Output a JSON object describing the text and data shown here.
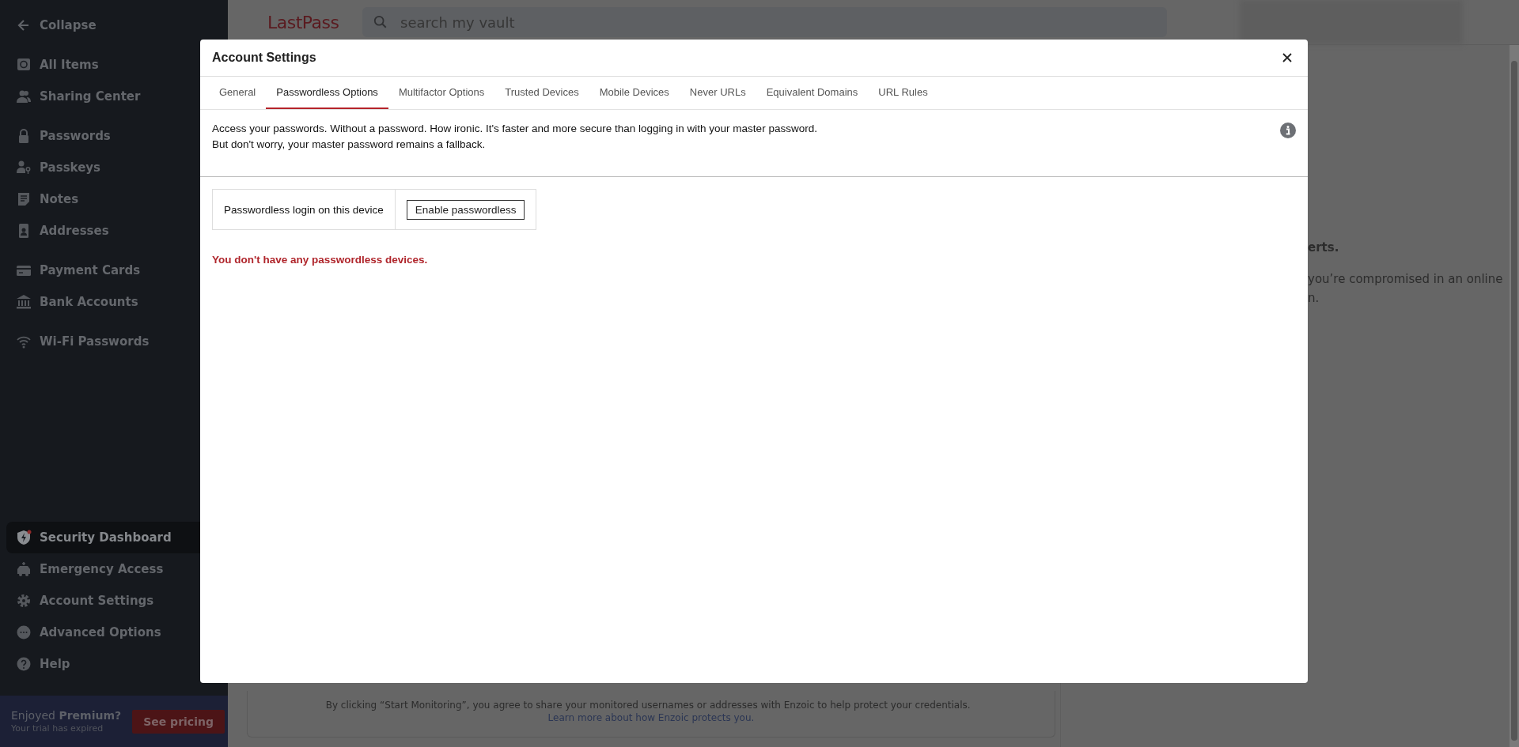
{
  "sidebar": {
    "collapse": "Collapse",
    "groups": [
      [
        {
          "label": "All Items",
          "selected": false
        },
        {
          "label": "Sharing Center",
          "selected": false
        }
      ],
      [
        {
          "label": "Passwords",
          "selected": false
        },
        {
          "label": "Passkeys",
          "selected": false
        },
        {
          "label": "Notes",
          "selected": false
        },
        {
          "label": "Addresses",
          "selected": false
        }
      ],
      [
        {
          "label": "Payment Cards",
          "selected": false
        },
        {
          "label": "Bank Accounts",
          "selected": false
        }
      ],
      [
        {
          "label": "Wi-Fi Passwords",
          "selected": false
        }
      ]
    ],
    "bottom_items": [
      {
        "label": "Security Dashboard",
        "selected": true
      },
      {
        "label": "Emergency Access",
        "selected": false
      },
      {
        "label": "Account Settings",
        "selected": false
      },
      {
        "label": "Advanced Options",
        "selected": false
      },
      {
        "label": "Help",
        "selected": false
      }
    ],
    "promo": {
      "headline": "Enjoyed **Premium?**",
      "subtext": "Your trial has expired",
      "button": "See pricing"
    }
  },
  "header": {
    "logo": "LastPass",
    "search": {
      "placeholder": "search my vault"
    }
  },
  "background": {
    "right_lines": [
      "erts.",
      "you’re compromised in an online",
      "n."
    ],
    "notice": {
      "text": "By clicking “Start Monitoring”, you agree to share your monitored usernames or addresses with Enzoic to help protect your credentials.",
      "link": "Learn more about how Enzoic protects you."
    }
  },
  "modal": {
    "title": "Account Settings",
    "tabs": [
      {
        "label": "General",
        "selected": false
      },
      {
        "label": "Passwordless Options",
        "selected": true
      },
      {
        "label": "Multifactor Options",
        "selected": false
      },
      {
        "label": "Trusted Devices",
        "selected": false
      },
      {
        "label": "Mobile Devices",
        "selected": false
      },
      {
        "label": "Never URLs",
        "selected": false
      },
      {
        "label": "Equivalent Domains",
        "selected": false
      },
      {
        "label": "URL Rules",
        "selected": false
      }
    ],
    "intro": [
      "Access your passwords. Without a password. How ironic. It's faster and more secure than logging in with your master password.",
      "But don't worry, your master password remains a fallback."
    ],
    "setting": {
      "label": "Passwordless login on this device",
      "button": "Enable passwordless"
    },
    "message": "You don't have any passwordless devices."
  }
}
